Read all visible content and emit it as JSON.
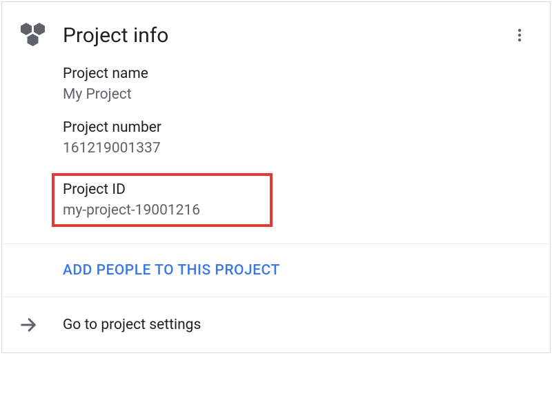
{
  "card": {
    "title": "Project info",
    "fields": {
      "name": {
        "label": "Project name",
        "value": "My Project"
      },
      "number": {
        "label": "Project number",
        "value": "161219001337"
      },
      "id": {
        "label": "Project ID",
        "value": "my-project-19001216"
      }
    },
    "action_link": "Add people to this project",
    "footer_link": "Go to project settings"
  }
}
